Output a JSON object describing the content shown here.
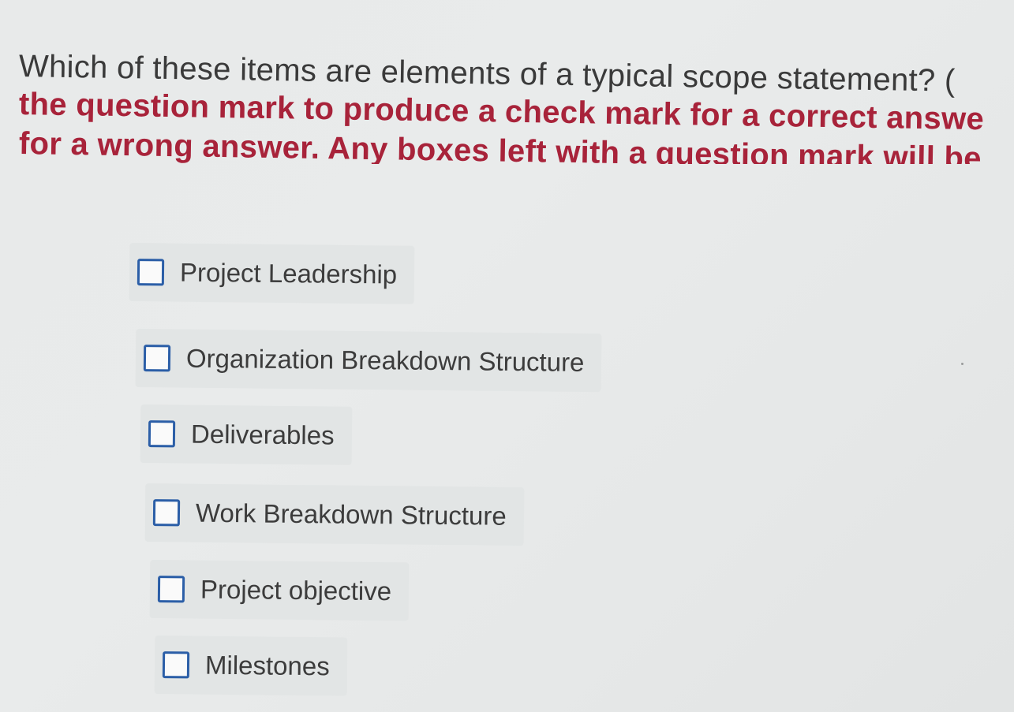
{
  "question": {
    "line1": "Which of these items are elements of a typical scope statement? (",
    "line2": "the question mark to produce a check mark for a correct answe",
    "line3": "for a wrong answer. Any boxes left with a question mark will be"
  },
  "options": [
    {
      "label": "Project Leadership"
    },
    {
      "label": "Organization Breakdown Structure"
    },
    {
      "label": "Deliverables"
    },
    {
      "label": "Work Breakdown Structure"
    },
    {
      "label": "Project objective"
    },
    {
      "label": "Milestones"
    }
  ],
  "colors": {
    "question_text": "#3a3a3a",
    "instruction_text": "#a8233a",
    "checkbox_border": "#2b5ea7",
    "background": "#e8eaea"
  }
}
